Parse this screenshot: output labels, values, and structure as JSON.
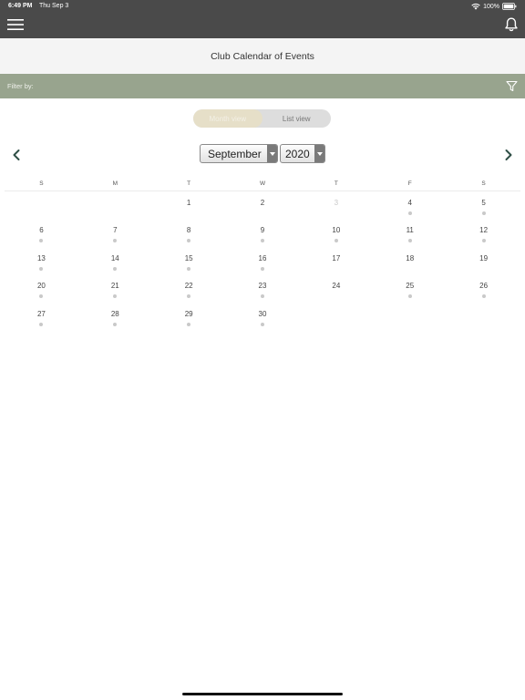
{
  "status_bar": {
    "time": "6:49 PM",
    "date": "Thu Sep 3",
    "battery": "100%"
  },
  "header": {
    "menu_icon": "hamburger-menu-icon",
    "bell_icon": "bell-icon"
  },
  "page": {
    "title": "Club Calendar of Events"
  },
  "filter": {
    "label": "Filter by:",
    "icon": "funnel-icon"
  },
  "view_toggle": {
    "month_label": "Month view",
    "list_label": "List view",
    "selected": "month"
  },
  "calendar": {
    "month": "September",
    "year": "2020",
    "weekdays": [
      "S",
      "M",
      "T",
      "W",
      "T",
      "F",
      "S"
    ],
    "weeks": [
      [
        {
          "day": "",
          "dot": false
        },
        {
          "day": "",
          "dot": false
        },
        {
          "day": "1",
          "dot": false
        },
        {
          "day": "2",
          "dot": false
        },
        {
          "day": "3",
          "dot": false,
          "muted": true
        },
        {
          "day": "4",
          "dot": true
        },
        {
          "day": "5",
          "dot": true
        }
      ],
      [
        {
          "day": "6",
          "dot": true
        },
        {
          "day": "7",
          "dot": true
        },
        {
          "day": "8",
          "dot": true
        },
        {
          "day": "9",
          "dot": true
        },
        {
          "day": "10",
          "dot": true
        },
        {
          "day": "11",
          "dot": true
        },
        {
          "day": "12",
          "dot": true
        }
      ],
      [
        {
          "day": "13",
          "dot": true
        },
        {
          "day": "14",
          "dot": true
        },
        {
          "day": "15",
          "dot": true
        },
        {
          "day": "16",
          "dot": true
        },
        {
          "day": "17",
          "dot": false
        },
        {
          "day": "18",
          "dot": false
        },
        {
          "day": "19",
          "dot": false
        }
      ],
      [
        {
          "day": "20",
          "dot": true
        },
        {
          "day": "21",
          "dot": true
        },
        {
          "day": "22",
          "dot": true
        },
        {
          "day": "23",
          "dot": true
        },
        {
          "day": "24",
          "dot": false
        },
        {
          "day": "25",
          "dot": true
        },
        {
          "day": "26",
          "dot": true
        }
      ],
      [
        {
          "day": "27",
          "dot": true
        },
        {
          "day": "28",
          "dot": true
        },
        {
          "day": "29",
          "dot": true
        },
        {
          "day": "30",
          "dot": true
        },
        {
          "day": "",
          "dot": false
        },
        {
          "day": "",
          "dot": false
        },
        {
          "day": "",
          "dot": false
        }
      ]
    ]
  },
  "colors": {
    "header_bg": "#4a4a4a",
    "filter_bar_bg": "#98a48e",
    "toggle_active_bg": "#e6dfc8",
    "nav_arrow": "#2f4f46",
    "event_dot": "#c9c9c9"
  }
}
